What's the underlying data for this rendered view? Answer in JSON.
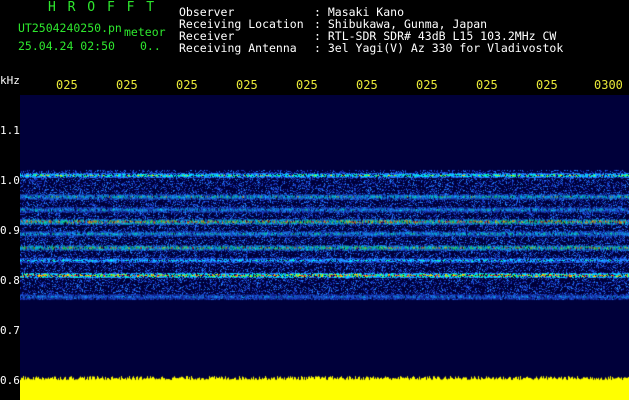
{
  "header": {
    "station_title": "H R O F F T",
    "file_name": "UT2504240250.pn",
    "meteor_label": "meteor",
    "datetime": "25.04.24 02:50",
    "count": "0..",
    "fields": [
      {
        "label": "Observer",
        "value": ": Masaki Kano"
      },
      {
        "label": "Receiving Location",
        "value": ": Shibukawa, Gunma, Japan"
      },
      {
        "label": "Receiver",
        "value": ": RTL-SDR SDR# 43dB L15 103.2MHz CW"
      },
      {
        "label": "Receiving Antenna",
        "value": ": 3el Yagi(V) Az 330 for Vladivostok"
      }
    ]
  },
  "time_axis": [
    "025",
    "025",
    "025",
    "025",
    "025",
    "025",
    "025",
    "025",
    "025",
    "0300"
  ],
  "y_axis": {
    "unit": "kHz",
    "ticks": [
      "1.1",
      "1.0",
      "0.9",
      "0.8",
      "0.7",
      "0.6"
    ]
  },
  "spectrogram": {
    "bands_khz": [
      1.01,
      0.967,
      0.941,
      0.917,
      0.893,
      0.865,
      0.84,
      0.81,
      0.767
    ],
    "band_strength": [
      0.7,
      0.65,
      0.55,
      0.9,
      0.6,
      0.8,
      0.55,
      0.9,
      0.45
    ],
    "noise_floor_khz": [
      0.76,
      1.02
    ],
    "bottom_bar_color": "#ffff00",
    "background_color": "#00003a"
  }
}
